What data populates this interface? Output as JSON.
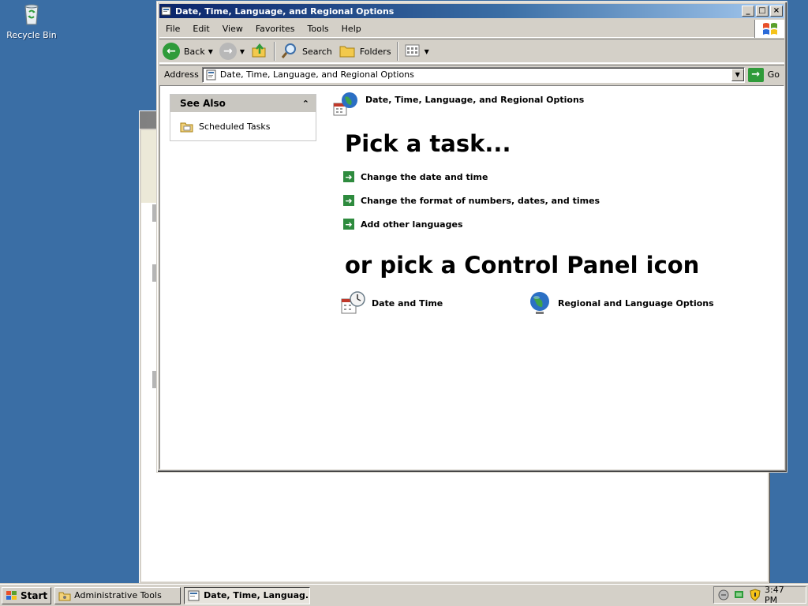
{
  "desktop": {
    "recycle_bin_label": "Recycle Bin"
  },
  "window": {
    "title": "Date, Time, Language, and Regional Options",
    "controls": {
      "minimize": "_",
      "maximize": "□",
      "close": "×"
    }
  },
  "menubar": {
    "items": [
      "File",
      "Edit",
      "View",
      "Favorites",
      "Tools",
      "Help"
    ]
  },
  "toolbar": {
    "back_label": "Back",
    "search_label": "Search",
    "folders_label": "Folders"
  },
  "address": {
    "label": "Address",
    "value": "Date, Time, Language, and Regional Options",
    "go_label": "Go"
  },
  "see_also": {
    "header": "See Also",
    "items": [
      "Scheduled Tasks"
    ]
  },
  "category": {
    "title": "Date, Time, Language, and Regional Options"
  },
  "pick_task_heading": "Pick a task...",
  "tasks": [
    "Change the date and time",
    "Change the format of numbers, dates, and times",
    "Add other languages"
  ],
  "pick_icon_heading": "or pick a Control Panel icon",
  "cp_icons": [
    {
      "label": "Date and Time",
      "icon": "date-time-icon"
    },
    {
      "label": "Regional and Language Options",
      "icon": "globe-icon"
    }
  ],
  "taskbar": {
    "start_label": "Start",
    "tasks": [
      {
        "label": "Administrative Tools",
        "active": false
      },
      {
        "label": "Date, Time, Languag...",
        "active": true
      }
    ],
    "clock": "3:47 PM"
  },
  "colors": {
    "desktop": "#3a6ea5",
    "title_active_start": "#0a246a",
    "title_active_end": "#a6caf0",
    "task_arrow": "#2e8b3e"
  }
}
